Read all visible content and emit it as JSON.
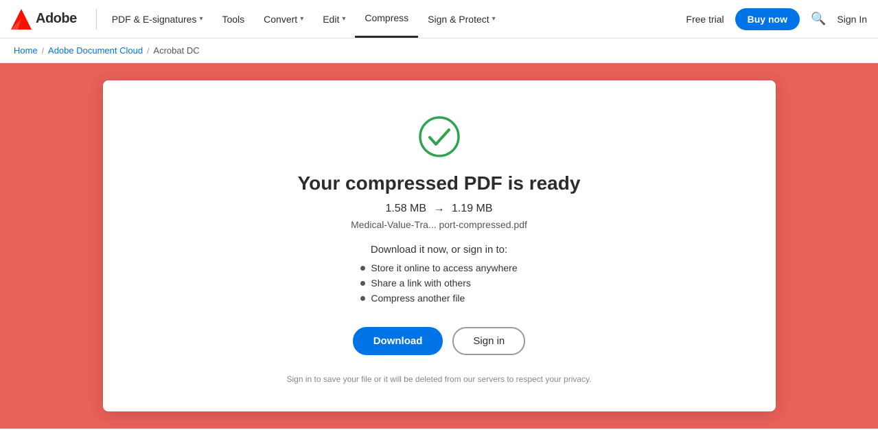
{
  "brand": {
    "logo_label": "Adobe",
    "wordmark": "Adobe"
  },
  "navbar": {
    "items": [
      {
        "id": "pdf-esignatures",
        "label": "PDF & E-signatures",
        "has_dropdown": true,
        "active": false
      },
      {
        "id": "tools",
        "label": "Tools",
        "has_dropdown": false,
        "active": false
      },
      {
        "id": "convert",
        "label": "Convert",
        "has_dropdown": true,
        "active": false
      },
      {
        "id": "edit",
        "label": "Edit",
        "has_dropdown": true,
        "active": false
      },
      {
        "id": "compress",
        "label": "Compress",
        "has_dropdown": false,
        "active": true
      },
      {
        "id": "sign-protect",
        "label": "Sign & Protect",
        "has_dropdown": true,
        "active": false
      }
    ],
    "free_trial": "Free trial",
    "buy_now": "Buy now",
    "sign_in": "Sign In"
  },
  "breadcrumb": {
    "items": [
      {
        "label": "Home",
        "href": "#"
      },
      {
        "label": "Adobe Document Cloud",
        "href": "#"
      },
      {
        "label": "Acrobat DC",
        "href": "#"
      }
    ]
  },
  "card": {
    "title": "Your compressed PDF is ready",
    "file_size_before": "1.58 MB",
    "arrow": "→",
    "file_size_after": "1.19 MB",
    "file_name": "Medical-Value-Tra... port-compressed.pdf",
    "download_prompt": "Download it now, or sign in to:",
    "benefits": [
      "Store it online to access anywhere",
      "Share a link with others",
      "Compress another file"
    ],
    "download_label": "Download",
    "signin_label": "Sign in",
    "privacy_note": "Sign in to save your file or it will be deleted from our servers to respect your privacy."
  }
}
